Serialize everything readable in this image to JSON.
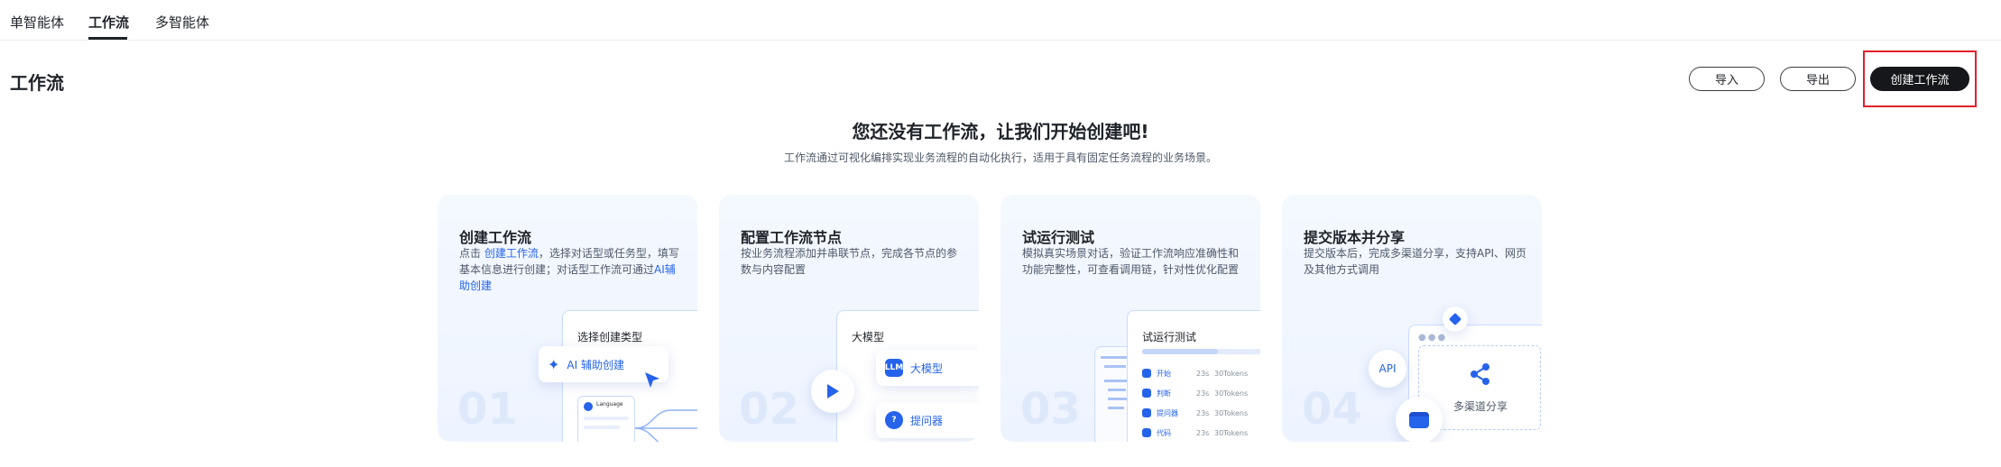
{
  "tabs": [
    {
      "label": "单智能体"
    },
    {
      "label": "工作流"
    },
    {
      "label": "多智能体"
    }
  ],
  "header": {
    "title": "工作流",
    "import_label": "导入",
    "export_label": "导出",
    "create_label": "创建工作流"
  },
  "empty": {
    "title": "您还没有工作流，让我们开始创建吧!",
    "subtitle": "工作流通过可视化编排实现业务流程的自动化执行，适用于具有固定任务流程的业务场景。"
  },
  "cards": [
    {
      "title": "创建工作流",
      "desc_prefix": "点击 ",
      "desc_link": "创建工作流",
      "desc_mid": "，选择对话型或任务型，填写基本信息进行创建；对话型工作流可通过",
      "desc_link2": "AI辅助创建",
      "number": "01",
      "panel_title": "选择创建类型",
      "pill_label": "AI 辅助创建",
      "mini_label": "Language"
    },
    {
      "title": "配置工作流节点",
      "desc": "按业务流程添加并串联节点，完成各节点的参数与内容配置",
      "number": "02",
      "panel_title": "大模型",
      "pill1_label": "大模型",
      "pill1_icon": "LLM",
      "pill2_label": "提问器"
    },
    {
      "title": "试运行测试",
      "desc": "模拟真实场景对话，验证工作流响应准确性和功能完整性，可查看调用链，针对性优化配置",
      "number": "03",
      "panel_title": "试运行测试",
      "rows": [
        {
          "label": "开始",
          "time": "23s",
          "tokens": "30Tokens"
        },
        {
          "label": "判断",
          "time": "23s",
          "tokens": "30Tokens"
        },
        {
          "label": "提问器",
          "time": "23s",
          "tokens": "30Tokens"
        },
        {
          "label": "代码",
          "time": "23s",
          "tokens": "30Tokens"
        }
      ]
    },
    {
      "title": "提交版本并分享",
      "desc": "提交版本后，完成多渠道分享，支持API、网页及其他方式调用",
      "number": "04",
      "api_label": "API",
      "share_label": "多渠道分享"
    }
  ],
  "colors": {
    "accent": "#2563eb",
    "highlight": "#e0202b",
    "dark_button": "#16171a"
  }
}
